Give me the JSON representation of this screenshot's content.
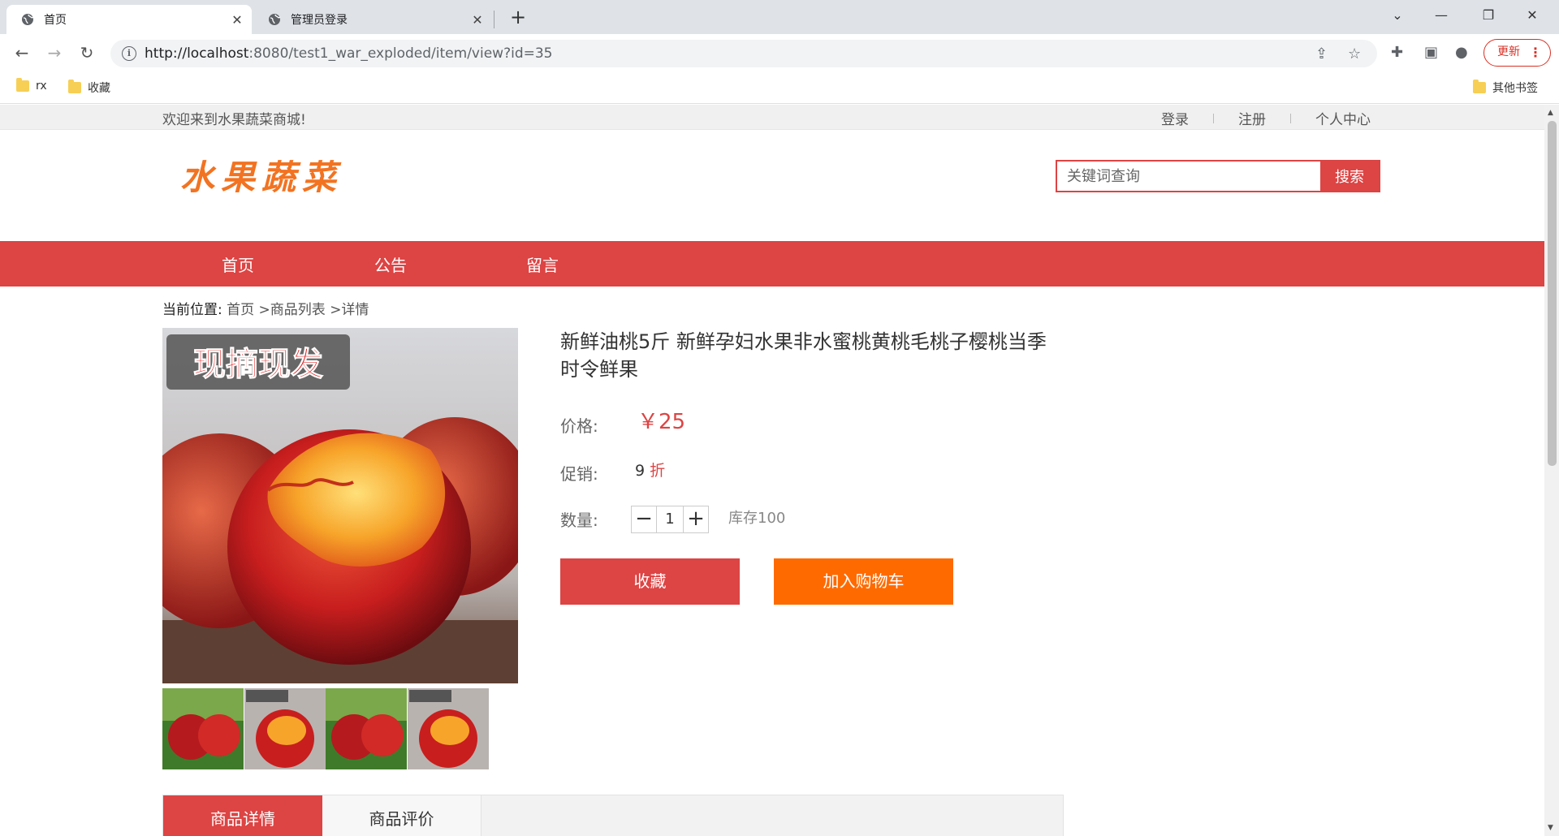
{
  "browser": {
    "tabs": [
      {
        "title": "首页",
        "active": true
      },
      {
        "title": "管理员登录",
        "active": false
      }
    ],
    "url_host": "http://localhost",
    "url_path": ":8080/test1_war_exploded/item/view?id=35",
    "update_label": "更新",
    "bookmarks": [
      "rx",
      "收藏"
    ],
    "other_bookmarks": "其他书签"
  },
  "topbar": {
    "welcome": "欢迎来到水果蔬菜商城!",
    "links": [
      "登录",
      "注册",
      "个人中心"
    ]
  },
  "header": {
    "logo": "水果蔬菜",
    "search_placeholder": "关键词查询",
    "search_button": "搜索"
  },
  "nav": [
    "首页",
    "公告",
    "留言"
  ],
  "breadcrumb": {
    "lead": "当前位置:",
    "path": "首页 >商品列表 >详情"
  },
  "product": {
    "image_banner": "现摘现发",
    "title": "新鲜油桃5斤 新鲜孕妇水果非水蜜桃黄桃毛桃子樱桃当季时令鲜果",
    "price_label": "价格:",
    "price": "￥25",
    "promo_label": "促销:",
    "promo_value": "9",
    "promo_unit": "折",
    "qty_label": "数量:",
    "qty_minus": "−",
    "qty": "1",
    "qty_plus": "+",
    "stock": "库存100",
    "fav_button": "收藏",
    "cart_button": "加入购物车"
  },
  "detail_tabs": [
    "商品详情",
    "商品评价"
  ],
  "colors": {
    "accent": "#dd4444",
    "cart": "#ff6a00",
    "logo": "#f27321"
  }
}
